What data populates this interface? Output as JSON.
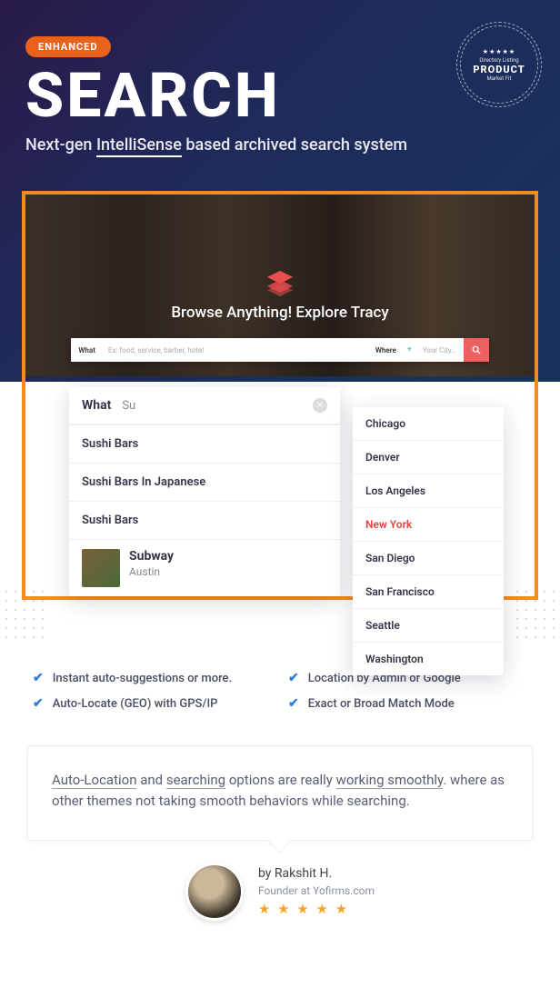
{
  "hero": {
    "badge": "ENHANCED",
    "title": "SEARCH",
    "subtitle_before": "Next-gen",
    "subtitle_highlight": "IntelliSense",
    "subtitle_after": "based archived search system"
  },
  "seal": {
    "stars": "★★★★★",
    "line1": "Directory Listing",
    "line2": "PRODUCT",
    "line3": "Market Fit"
  },
  "browser": {
    "tagline": "Browse Anything! Explore Tracy",
    "what_label": "What",
    "what_placeholder": "Ex: food, service, barber, hotel",
    "where_label": "Where",
    "where_placeholder": "Your City…"
  },
  "what_dropdown": {
    "label": "What",
    "query": "Su",
    "items": [
      {
        "title": "Sushi Bars"
      },
      {
        "title": "Sushi Bars In Japanese"
      },
      {
        "title": "Sushi Bars"
      }
    ],
    "rich": {
      "title": "Subway",
      "subtitle": "Austin"
    }
  },
  "where_dropdown": {
    "cities": [
      {
        "name": "Chicago",
        "active": false
      },
      {
        "name": "Denver",
        "active": false
      },
      {
        "name": "Los Angeles",
        "active": false
      },
      {
        "name": "New York",
        "active": true
      },
      {
        "name": "San Diego",
        "active": false
      },
      {
        "name": "San Francisco",
        "active": false
      },
      {
        "name": "Seattle",
        "active": false
      },
      {
        "name": "Washington",
        "active": false
      }
    ]
  },
  "features": [
    "Instant auto-suggestions or more.",
    "Location by Admin or Google",
    "Auto-Locate (GEO) with GPS/IP",
    "Exact or Broad Match Mode"
  ],
  "testimonial": {
    "u1": "Auto-Location",
    "t1": " and ",
    "u2": "searching",
    "t2": " options are really ",
    "u3": "working smoothly",
    "t3": ". where as other themes not taking smooth behaviors while searching."
  },
  "author": {
    "by": "by Rakshit H.",
    "role": "Founder at Yofirms.com",
    "stars": "★ ★ ★ ★ ★"
  }
}
